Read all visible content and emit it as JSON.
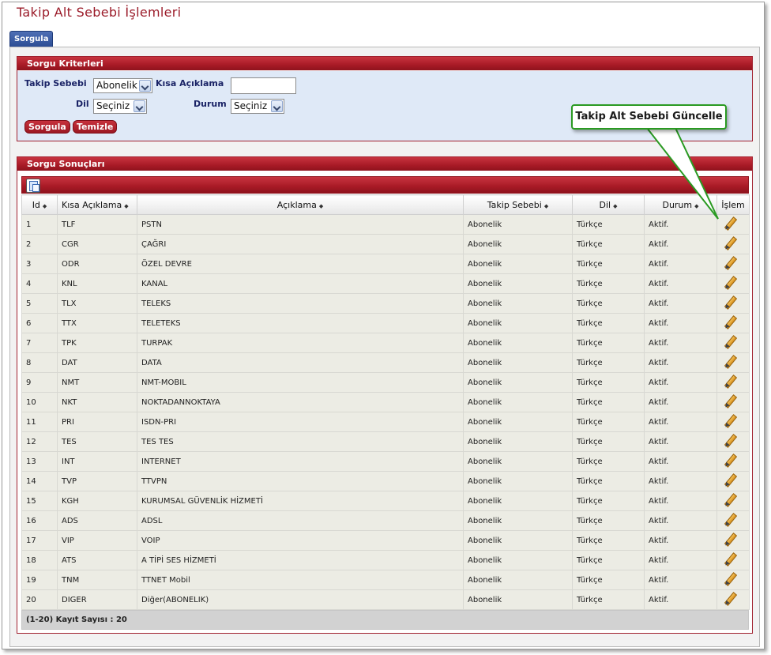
{
  "page": {
    "title": "Takip Alt Sebebi İşlemleri"
  },
  "tabs": [
    {
      "label": "Sorgula"
    }
  ],
  "criteria": {
    "header": "Sorgu Kriterleri",
    "takip_sebebi": {
      "label": "Takip Sebebi",
      "value": "Abonelik"
    },
    "kisa_aciklama": {
      "label": "Kısa Açıklama",
      "value": ""
    },
    "dil": {
      "label": "Dil",
      "value": "Seçiniz"
    },
    "durum": {
      "label": "Durum",
      "value": "Seçiniz"
    },
    "buttons": {
      "search": "Sorgula",
      "clear": "Temizle"
    }
  },
  "results": {
    "header": "Sorgu Sonuçları",
    "columns": [
      "Id",
      "Kısa Açıklama",
      "Açıklama",
      "Takip Sebebi",
      "Dil",
      "Durum",
      "İşlem"
    ],
    "sort_glyph": "◆",
    "rows": [
      [
        "1",
        "TLF",
        "PSTN",
        "Abonelik",
        "Türkçe",
        "Aktif."
      ],
      [
        "2",
        "CGR",
        "ÇAĞRI",
        "Abonelik",
        "Türkçe",
        "Aktif."
      ],
      [
        "3",
        "ODR",
        "ÖZEL DEVRE",
        "Abonelik",
        "Türkçe",
        "Aktif."
      ],
      [
        "4",
        "KNL",
        "KANAL",
        "Abonelik",
        "Türkçe",
        "Aktif."
      ],
      [
        "5",
        "TLX",
        "TELEKS",
        "Abonelik",
        "Türkçe",
        "Aktif."
      ],
      [
        "6",
        "TTX",
        "TELETEKS",
        "Abonelik",
        "Türkçe",
        "Aktif."
      ],
      [
        "7",
        "TPK",
        "TURPAK",
        "Abonelik",
        "Türkçe",
        "Aktif."
      ],
      [
        "8",
        "DAT",
        "DATA",
        "Abonelik",
        "Türkçe",
        "Aktif."
      ],
      [
        "9",
        "NMT",
        "NMT-MOBIL",
        "Abonelik",
        "Türkçe",
        "Aktif."
      ],
      [
        "10",
        "NKT",
        "NOKTADANNOKTAYA",
        "Abonelik",
        "Türkçe",
        "Aktif."
      ],
      [
        "11",
        "PRI",
        "ISDN-PRI",
        "Abonelik",
        "Türkçe",
        "Aktif."
      ],
      [
        "12",
        "TES",
        "TES TES",
        "Abonelik",
        "Türkçe",
        "Aktif."
      ],
      [
        "13",
        "INT",
        "INTERNET",
        "Abonelik",
        "Türkçe",
        "Aktif."
      ],
      [
        "14",
        "TVP",
        "TTVPN",
        "Abonelik",
        "Türkçe",
        "Aktif."
      ],
      [
        "15",
        "KGH",
        "KURUMSAL GÜVENLİK HİZMETİ",
        "Abonelik",
        "Türkçe",
        "Aktif."
      ],
      [
        "16",
        "ADS",
        "ADSL",
        "Abonelik",
        "Türkçe",
        "Aktif."
      ],
      [
        "17",
        "VIP",
        "VOIP",
        "Abonelik",
        "Türkçe",
        "Aktif."
      ],
      [
        "18",
        "ATS",
        "A TİPİ SES HİZMETİ",
        "Abonelik",
        "Türkçe",
        "Aktif."
      ],
      [
        "19",
        "TNM",
        "TTNET Mobil",
        "Abonelik",
        "Türkçe",
        "Aktif."
      ],
      [
        "20",
        "DIGER",
        "Diğer(ABONELIK)",
        "Abonelik",
        "Türkçe",
        "Aktif."
      ]
    ],
    "icons": {
      "export": "export-icon",
      "edit": "pencil-icon"
    },
    "footer": "(1-20) Kayıt Sayısı : 20"
  },
  "callout": {
    "text": "Takip Alt Sebebi Güncelle"
  },
  "colors": {
    "brand_red": "#a81a26",
    "title_red": "#9b1c2a",
    "label_navy": "#1a2366",
    "callout_green": "#2a9a22",
    "tab_blue": "#2b4c93"
  }
}
